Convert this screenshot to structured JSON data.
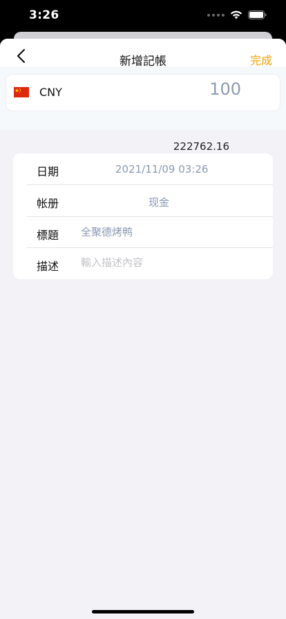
{
  "status_bar": {
    "time": "3:26"
  },
  "nav": {
    "title": "新增記帳",
    "done_label": "完成"
  },
  "currency": {
    "code": "CNY",
    "amount": "100",
    "converted": "222762.16"
  },
  "form": {
    "date": {
      "label": "日期",
      "value": "2021/11/09 03:26"
    },
    "ledger": {
      "label": "帐册",
      "value": "现金"
    },
    "title": {
      "label": "標題",
      "value": "全聚德烤鸭"
    },
    "description": {
      "label": "描述",
      "placeholder": "輸入描述內容"
    }
  },
  "colors": {
    "accent": "#f2a100",
    "value_text": "#8a99b3",
    "background": "#f2f2f7"
  }
}
